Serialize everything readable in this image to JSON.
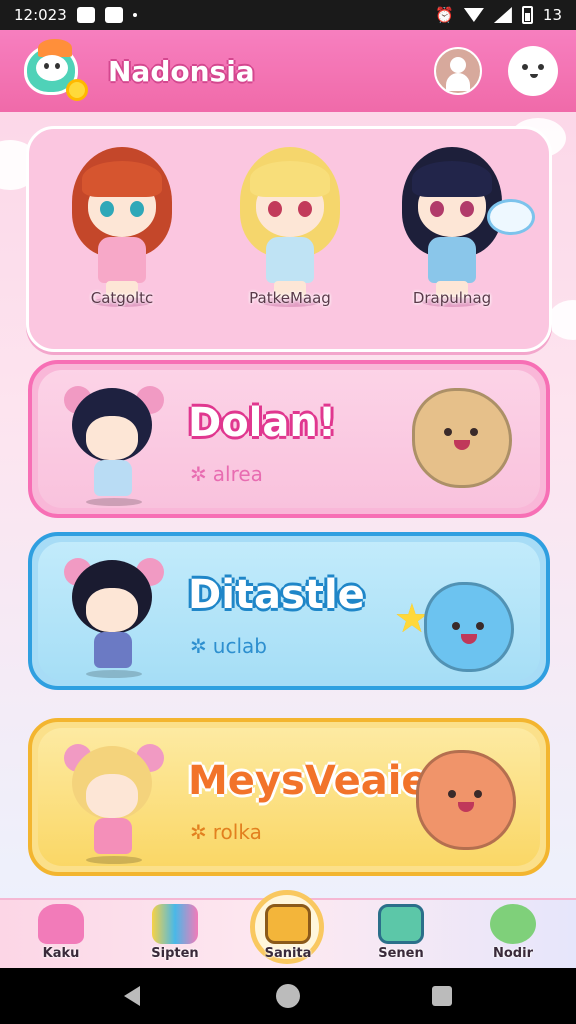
{
  "status_bar": {
    "time": "12:023",
    "battery_text": "13"
  },
  "header": {
    "app_title": "Nadonsia"
  },
  "characters": [
    {
      "label": "Catgoltc"
    },
    {
      "label": "PatkeMaag"
    },
    {
      "label": "Drapulnag"
    }
  ],
  "cards": [
    {
      "title": "Dolan!",
      "subtitle": "alrea",
      "sub_icon": "✲"
    },
    {
      "title": "Ditastle",
      "subtitle": "uclab",
      "sub_icon": "✲"
    },
    {
      "title": "MeysVeaie",
      "subtitle": "rolka",
      "sub_icon": "✲"
    }
  ],
  "bottom_nav": [
    {
      "label": "Kaku"
    },
    {
      "label": "Sipten"
    },
    {
      "label": "Sanita"
    },
    {
      "label": "Senen"
    },
    {
      "label": "Nodir"
    }
  ],
  "colors": {
    "header_pink": "#f06aa9",
    "card_pink": "#f86fb8",
    "card_blue": "#3fa9e6",
    "card_yellow": "#f7c43a"
  }
}
